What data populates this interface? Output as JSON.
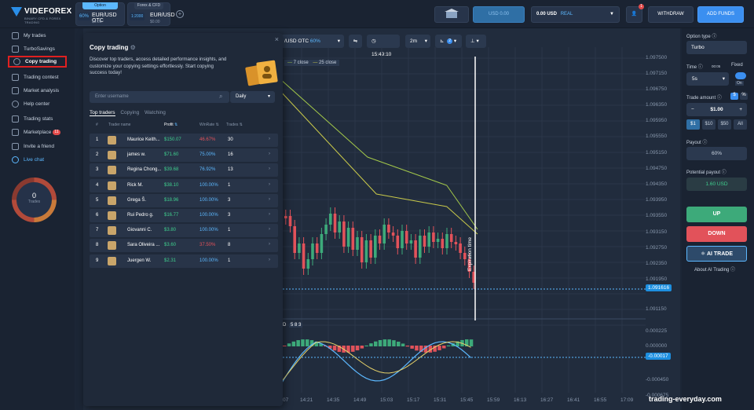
{
  "brand": {
    "name": "VIDEFOREX",
    "tagline": "BINARY CFD & FOREX TRADING"
  },
  "tabs": [
    {
      "caption": "Option",
      "pct": "60%",
      "symbol": "EUR/USD OTC",
      "sub": "$0.00"
    },
    {
      "caption": "Forex & CFD",
      "pct": "1:2000",
      "symbol": "EUR/USD",
      "sub": "$0.00"
    }
  ],
  "topbar": {
    "demo_amount": "USD 0.00",
    "balance": "0.00 USD",
    "account": "REAL",
    "notif_count": "1",
    "withdraw": "WITHDRAW",
    "add_funds": "ADD FUNDS"
  },
  "sidebar": {
    "items": [
      {
        "label": "My trades"
      },
      {
        "label": "TurboSavings"
      },
      {
        "label": "Copy trading"
      },
      {
        "label": "Trading contest"
      },
      {
        "label": "Market analysis"
      },
      {
        "label": "Help center"
      },
      {
        "label": "Trading stats"
      },
      {
        "label": "Marketplace",
        "badge": "11"
      },
      {
        "label": "Invite a friend"
      },
      {
        "label": "Live chat"
      }
    ],
    "trades_count": "0",
    "trades_label": "Trades"
  },
  "chart_toolbar": {
    "asset": "/USD OTC",
    "asset_pct": "60%",
    "time": "15:49:10",
    "interval": "2m",
    "indicators": "2"
  },
  "legend": {
    "ma7": "7 close",
    "ma25": "25 close"
  },
  "macd_label": "D",
  "macd_values": "5  8  3",
  "expiration_label": "Expiration time",
  "y_ticks": [
    "1.097500",
    "1.097150",
    "1.096750",
    "1.096350",
    "1.095950",
    "1.095550",
    "1.095150",
    "1.094750",
    "1.094350",
    "1.093950",
    "1.093550",
    "1.093150",
    "1.092750",
    "1.092350",
    "1.091950",
    "1.091550",
    "1.091150"
  ],
  "price_marker": "1.091616",
  "macd_ticks": [
    "0.000225",
    "0.000000",
    "-0.000225",
    "-0.000450",
    "-0.000675"
  ],
  "macd_marker": "-0.00017",
  "x_ticks": [
    "07",
    "14:21",
    "14:35",
    "14:49",
    "15:03",
    "15:17",
    "15:31",
    "15:45",
    "15:59",
    "16:13",
    "16:27",
    "16:41",
    "16:55",
    "17:09"
  ],
  "copy_panel": {
    "title": "Copy trading",
    "desc": "Discover top traders, access detailed performance insights, and customize your copying settings effortlessly. Start copying success today!",
    "search_placeholder": "Enter username",
    "period": "Daily",
    "tabs": [
      "Top traders",
      "Copying",
      "Watching"
    ],
    "headers": {
      "num": "#",
      "name": "Trader name",
      "profit": "Profit",
      "winrate": "WinRate",
      "trades": "Trades"
    },
    "rows": [
      {
        "n": "1",
        "name": "Maurice Keith...",
        "profit": "$150.07",
        "winrate": "46.67%",
        "trades": "30"
      },
      {
        "n": "2",
        "name": "james w.",
        "profit": "$71.60",
        "winrate": "75.00%",
        "trades": "16"
      },
      {
        "n": "3",
        "name": "Regina Chong...",
        "profit": "$39.68",
        "winrate": "76.92%",
        "trades": "13"
      },
      {
        "n": "4",
        "name": "Rick M.",
        "profit": "$38.10",
        "winrate": "100.00%",
        "trades": "1"
      },
      {
        "n": "5",
        "name": "Grega Š.",
        "profit": "$18.96",
        "winrate": "100.00%",
        "trades": "3"
      },
      {
        "n": "6",
        "name": "Rui Pedro g.",
        "profit": "$16.77",
        "winrate": "100.00%",
        "trades": "3"
      },
      {
        "n": "7",
        "name": "Giovanni C.",
        "profit": "$3.80",
        "winrate": "100.00%",
        "trades": "1"
      },
      {
        "n": "8",
        "name": "Sara Oliveira ...",
        "profit": "$3.60",
        "winrate": "37.50%",
        "trades": "8"
      },
      {
        "n": "9",
        "name": "Juergen W.",
        "profit": "$2.31",
        "winrate": "100.00%",
        "trades": "1"
      }
    ]
  },
  "right": {
    "option_type_label": "Option type",
    "option_type": "Turbo",
    "time_label": "Time",
    "time_small": "00:05",
    "fixed_label": "Fixed",
    "time_value": "5s",
    "toggle": "On",
    "trade_amount_label": "Trade amount",
    "pct_label": "%",
    "amount": "$1.00",
    "presets": [
      "$1",
      "$10",
      "$50",
      "All"
    ],
    "payout_label": "Payout",
    "payout": "60%",
    "potential_label": "Potential payout",
    "potential": "1.60 USD",
    "up": "UP",
    "down": "DOWN",
    "ai": "AI TRADE",
    "about_ai": "About AI Trading"
  },
  "watermark": "trading-everyday.com"
}
